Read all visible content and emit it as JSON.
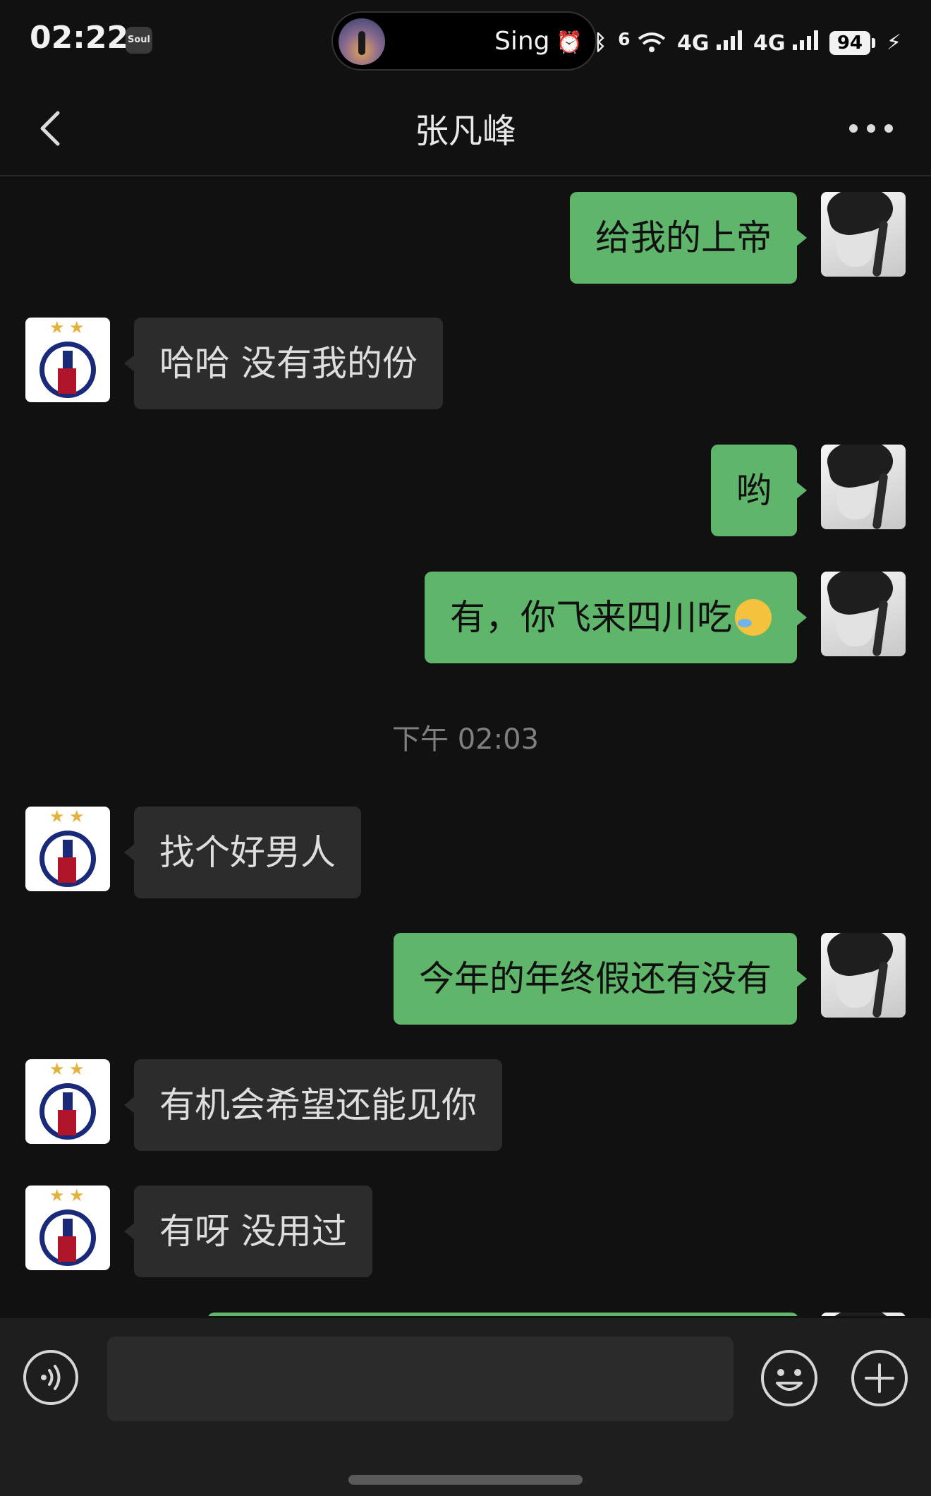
{
  "status_bar": {
    "time": "02:22",
    "app_badge": "Soul",
    "now_playing": "Sing M",
    "network_1": "4G",
    "network_2": "4G",
    "wifi_gen": "6",
    "battery": "94"
  },
  "header": {
    "title": "张凡峰"
  },
  "messages": [
    {
      "side": "me",
      "text": "给我的上帝"
    },
    {
      "side": "them",
      "text": "哈哈 没有我的份"
    },
    {
      "side": "me",
      "text": "哟"
    },
    {
      "side": "me",
      "text": "有，你飞来四川吃",
      "emoji": "laughing-crying-emoji"
    },
    {
      "side": "them",
      "text": "找个好男人"
    },
    {
      "side": "me",
      "text": "今年的年终假还有没有"
    },
    {
      "side": "them",
      "text": "有机会希望还能见你"
    },
    {
      "side": "them",
      "text": "有呀 没用过"
    }
  ],
  "timestamp": "下午 02:03",
  "input": {
    "value": "",
    "placeholder": ""
  },
  "colors": {
    "background": "#111111",
    "my_bubble": "#5fb56a",
    "their_bubble": "#2c2c2c",
    "input_bar": "#1e1e1e"
  }
}
